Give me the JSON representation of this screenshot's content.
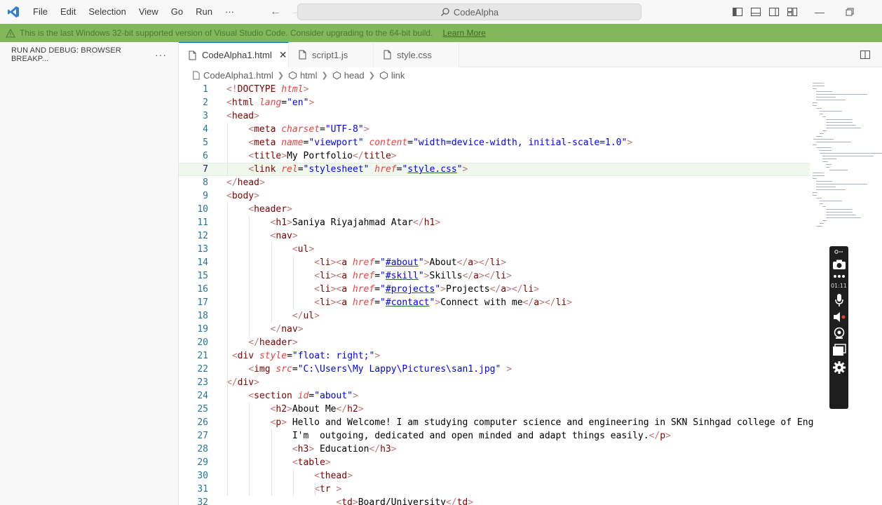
{
  "titlebar": {
    "menu": [
      "File",
      "Edit",
      "Selection",
      "View",
      "Go",
      "Run",
      "···"
    ],
    "search": "CodeAlpha"
  },
  "banner": {
    "message": "This is the last Windows 32-bit supported version of Visual Studio Code. Consider upgrading to the 64-bit build.",
    "link": "Learn More"
  },
  "sidebar": {
    "title": "RUN AND DEBUG: BROWSER BREAKP...",
    "more": "···"
  },
  "tabs": [
    {
      "label": "CodeAlpha1.html",
      "active": true
    },
    {
      "label": "script1.js",
      "active": false
    },
    {
      "label": "style.css",
      "active": false
    }
  ],
  "breadcrumb": [
    "CodeAlpha1.html",
    "html",
    "head",
    "link"
  ],
  "recorder": {
    "time": "01:11"
  },
  "code": {
    "numbers": [
      "1",
      "2",
      "3",
      "4",
      "5",
      "6",
      "7",
      "8",
      "9",
      "10",
      "11",
      "12",
      "13",
      "14",
      "15",
      "16",
      "17",
      "18",
      "19",
      "20",
      "21",
      "22",
      "23",
      "24",
      "25",
      "26",
      "27",
      "28",
      "29",
      "30",
      "31",
      "32"
    ],
    "lines": [
      {
        "i": 0,
        "t": [
          [
            "br",
            "<!"
          ],
          [
            "tg",
            "DOCTYPE "
          ],
          [
            "at",
            "html"
          ],
          [
            "br",
            ">"
          ]
        ]
      },
      {
        "i": 0,
        "t": [
          [
            "br",
            "<"
          ],
          [
            "tg",
            "html "
          ],
          [
            "at",
            "lang"
          ],
          [
            "tx",
            "="
          ],
          [
            "vl",
            "\"en\""
          ],
          [
            "br",
            ">"
          ]
        ]
      },
      {
        "i": 0,
        "t": [
          [
            "br",
            "<"
          ],
          [
            "tg",
            "head"
          ],
          [
            "br",
            ">"
          ]
        ]
      },
      {
        "i": 4,
        "t": [
          [
            "br",
            "<"
          ],
          [
            "tg",
            "meta "
          ],
          [
            "at",
            "charset"
          ],
          [
            "tx",
            "="
          ],
          [
            "vl",
            "\"UTF-8\""
          ],
          [
            "br",
            ">"
          ]
        ]
      },
      {
        "i": 4,
        "t": [
          [
            "br",
            "<"
          ],
          [
            "tg",
            "meta "
          ],
          [
            "at",
            "name"
          ],
          [
            "tx",
            "="
          ],
          [
            "vl",
            "\"viewport\" "
          ],
          [
            "at",
            "content"
          ],
          [
            "tx",
            "="
          ],
          [
            "vl",
            "\"width=device-width, initial-scale=1.0\""
          ],
          [
            "br",
            ">"
          ]
        ]
      },
      {
        "i": 4,
        "t": [
          [
            "br",
            "<"
          ],
          [
            "tg",
            "title"
          ],
          [
            "br",
            ">"
          ],
          [
            "tx",
            "My Portfolio"
          ],
          [
            "br",
            "</"
          ],
          [
            "tg",
            "title"
          ],
          [
            "br",
            ">"
          ]
        ]
      },
      {
        "i": 4,
        "t": [
          [
            "br",
            "<"
          ],
          [
            "tg",
            "link "
          ],
          [
            "at",
            "rel"
          ],
          [
            "tx",
            "="
          ],
          [
            "vl",
            "\"stylesheet\" "
          ],
          [
            "at",
            "href"
          ],
          [
            "tx",
            "="
          ],
          [
            "vl",
            "\""
          ],
          [
            "vu",
            "style.css"
          ],
          [
            "vl",
            "\""
          ],
          [
            "br",
            ">"
          ]
        ]
      },
      {
        "i": 0,
        "t": [
          [
            "br",
            "</"
          ],
          [
            "tg",
            "head"
          ],
          [
            "br",
            ">"
          ]
        ]
      },
      {
        "i": 0,
        "t": [
          [
            "br",
            "<"
          ],
          [
            "tg",
            "body"
          ],
          [
            "br",
            ">"
          ]
        ]
      },
      {
        "i": 4,
        "t": [
          [
            "br",
            "<"
          ],
          [
            "tg",
            "header"
          ],
          [
            "br",
            ">"
          ]
        ]
      },
      {
        "i": 8,
        "t": [
          [
            "br",
            "<"
          ],
          [
            "tg",
            "h1"
          ],
          [
            "br",
            ">"
          ],
          [
            "tx",
            "Saniya Riyajahmad Atar"
          ],
          [
            "br",
            "</"
          ],
          [
            "tg",
            "h1"
          ],
          [
            "br",
            ">"
          ]
        ]
      },
      {
        "i": 8,
        "t": [
          [
            "br",
            "<"
          ],
          [
            "tg",
            "nav"
          ],
          [
            "br",
            ">"
          ]
        ]
      },
      {
        "i": 12,
        "t": [
          [
            "br",
            "<"
          ],
          [
            "tg",
            "ul"
          ],
          [
            "br",
            ">"
          ]
        ]
      },
      {
        "i": 16,
        "t": [
          [
            "br",
            "<"
          ],
          [
            "tg",
            "li"
          ],
          [
            "br",
            "><"
          ],
          [
            "tg",
            "a "
          ],
          [
            "at",
            "href"
          ],
          [
            "tx",
            "="
          ],
          [
            "vl",
            "\""
          ],
          [
            "vu",
            "#about"
          ],
          [
            "vl",
            "\""
          ],
          [
            "br",
            ">"
          ],
          [
            "tx",
            "About"
          ],
          [
            "br",
            "</"
          ],
          [
            "tg",
            "a"
          ],
          [
            "br",
            "></"
          ],
          [
            "tg",
            "li"
          ],
          [
            "br",
            ">"
          ]
        ]
      },
      {
        "i": 16,
        "t": [
          [
            "br",
            "<"
          ],
          [
            "tg",
            "li"
          ],
          [
            "br",
            "><"
          ],
          [
            "tg",
            "a "
          ],
          [
            "at",
            "href"
          ],
          [
            "tx",
            "="
          ],
          [
            "vl",
            "\""
          ],
          [
            "vu",
            "#skill"
          ],
          [
            "vl",
            "\""
          ],
          [
            "br",
            ">"
          ],
          [
            "tx",
            "Skills"
          ],
          [
            "br",
            "</"
          ],
          [
            "tg",
            "a"
          ],
          [
            "br",
            "></"
          ],
          [
            "tg",
            "li"
          ],
          [
            "br",
            ">"
          ]
        ]
      },
      {
        "i": 16,
        "t": [
          [
            "br",
            "<"
          ],
          [
            "tg",
            "li"
          ],
          [
            "br",
            "><"
          ],
          [
            "tg",
            "a "
          ],
          [
            "at",
            "href"
          ],
          [
            "tx",
            "="
          ],
          [
            "vl",
            "\""
          ],
          [
            "vu",
            "#projects"
          ],
          [
            "vl",
            "\""
          ],
          [
            "br",
            ">"
          ],
          [
            "tx",
            "Projects"
          ],
          [
            "br",
            "</"
          ],
          [
            "tg",
            "a"
          ],
          [
            "br",
            "></"
          ],
          [
            "tg",
            "li"
          ],
          [
            "br",
            ">"
          ]
        ]
      },
      {
        "i": 16,
        "t": [
          [
            "br",
            "<"
          ],
          [
            "tg",
            "li"
          ],
          [
            "br",
            "><"
          ],
          [
            "tg",
            "a "
          ],
          [
            "at",
            "href"
          ],
          [
            "tx",
            "="
          ],
          [
            "vl",
            "\""
          ],
          [
            "vu",
            "#contact"
          ],
          [
            "vl",
            "\""
          ],
          [
            "br",
            ">"
          ],
          [
            "tx",
            "Connect with me"
          ],
          [
            "br",
            "</"
          ],
          [
            "tg",
            "a"
          ],
          [
            "br",
            "></"
          ],
          [
            "tg",
            "li"
          ],
          [
            "br",
            ">"
          ]
        ]
      },
      {
        "i": 12,
        "t": [
          [
            "br",
            "</"
          ],
          [
            "tg",
            "ul"
          ],
          [
            "br",
            ">"
          ]
        ]
      },
      {
        "i": 8,
        "t": [
          [
            "br",
            "</"
          ],
          [
            "tg",
            "nav"
          ],
          [
            "br",
            ">"
          ]
        ]
      },
      {
        "i": 4,
        "t": [
          [
            "br",
            "</"
          ],
          [
            "tg",
            "header"
          ],
          [
            "br",
            ">"
          ]
        ]
      },
      {
        "i": 1,
        "t": [
          [
            "br",
            "<"
          ],
          [
            "tg",
            "div "
          ],
          [
            "at",
            "style"
          ],
          [
            "tx",
            "="
          ],
          [
            "vl",
            "\"float: right;\""
          ],
          [
            "br",
            ">"
          ]
        ]
      },
      {
        "i": 4,
        "t": [
          [
            "br",
            "<"
          ],
          [
            "tg",
            "img "
          ],
          [
            "at",
            "src"
          ],
          [
            "tx",
            "="
          ],
          [
            "vl",
            "\"C:\\Users\\My Lappy\\Pictures\\san1.jpg\" "
          ],
          [
            "br",
            ">"
          ]
        ]
      },
      {
        "i": 0,
        "t": [
          [
            "br",
            "</"
          ],
          [
            "tg",
            "div"
          ],
          [
            "br",
            ">"
          ]
        ]
      },
      {
        "i": 4,
        "t": [
          [
            "br",
            "<"
          ],
          [
            "tg",
            "section "
          ],
          [
            "at",
            "id"
          ],
          [
            "tx",
            "="
          ],
          [
            "vl",
            "\"about\""
          ],
          [
            "br",
            ">"
          ]
        ]
      },
      {
        "i": 8,
        "t": [
          [
            "br",
            "<"
          ],
          [
            "tg",
            "h2"
          ],
          [
            "br",
            ">"
          ],
          [
            "tx",
            "About Me"
          ],
          [
            "br",
            "</"
          ],
          [
            "tg",
            "h2"
          ],
          [
            "br",
            ">"
          ]
        ]
      },
      {
        "i": 8,
        "t": [
          [
            "br",
            "<"
          ],
          [
            "tg",
            "p"
          ],
          [
            "br",
            "> "
          ],
          [
            "tx",
            "Hello and Welcome! I am studying computer science and engineering in SKN Sinhgad college of Eng"
          ]
        ]
      },
      {
        "i": 12,
        "t": [
          [
            "tx",
            "I'm  outgoing, dedicated and open minded and adapt things easily."
          ],
          [
            "br",
            "</"
          ],
          [
            "tg",
            "p"
          ],
          [
            "br",
            ">"
          ]
        ]
      },
      {
        "i": 12,
        "t": [
          [
            "br",
            "<"
          ],
          [
            "tg",
            "h3"
          ],
          [
            "br",
            "> "
          ],
          [
            "tx",
            "Education"
          ],
          [
            "br",
            "</"
          ],
          [
            "tg",
            "h3"
          ],
          [
            "br",
            ">"
          ]
        ]
      },
      {
        "i": 12,
        "t": [
          [
            "br",
            "<"
          ],
          [
            "tg",
            "table"
          ],
          [
            "br",
            ">"
          ]
        ]
      },
      {
        "i": 16,
        "t": [
          [
            "br",
            "<"
          ],
          [
            "tg",
            "thead"
          ],
          [
            "br",
            ">"
          ]
        ]
      },
      {
        "i": 16,
        "t": [
          [
            "br",
            "<"
          ],
          [
            "tg",
            "tr "
          ],
          [
            "br",
            ">"
          ]
        ]
      },
      {
        "i": 20,
        "t": [
          [
            "br",
            "<"
          ],
          [
            "tg",
            "td"
          ],
          [
            "br",
            ">"
          ],
          [
            "tx",
            "Board/University"
          ],
          [
            "br",
            "</"
          ],
          [
            "tg",
            "td"
          ],
          [
            "br",
            ">"
          ]
        ]
      }
    ]
  }
}
